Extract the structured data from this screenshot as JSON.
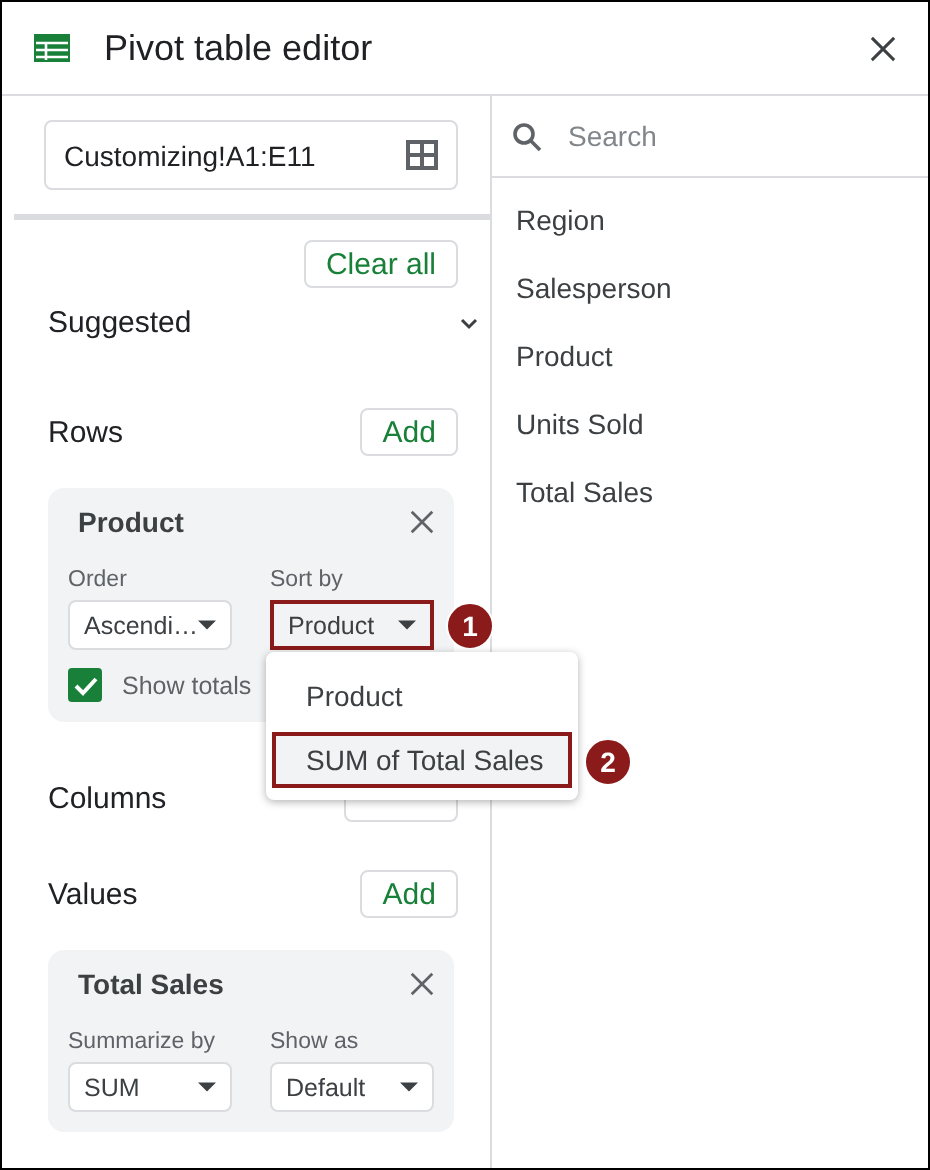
{
  "window": {
    "title": "Pivot table editor"
  },
  "range": {
    "value": "Customizing!A1:E11"
  },
  "clear_all": "Clear all",
  "suggested": "Suggested",
  "sections": [
    {
      "label": "Rows",
      "button": "Add",
      "card": {
        "title": "Product",
        "dropdowns": [
          {
            "label": "Order",
            "value": "Ascendi…",
            "highlighted": false
          },
          {
            "label": "Sort by",
            "value": "Product",
            "highlighted": true,
            "callout": "1"
          }
        ],
        "checkbox": {
          "label": "Show totals",
          "checked": true
        }
      }
    },
    {
      "label": "Columns"
    },
    {
      "label": "Values",
      "button": "Add",
      "card": {
        "title": "Total Sales",
        "dropdowns": [
          {
            "label": "Summarize by",
            "value": "SUM",
            "highlighted": false
          },
          {
            "label": "Show as",
            "value": "Default",
            "highlighted": false
          }
        ]
      }
    }
  ],
  "menu": {
    "items": [
      {
        "label": "Product",
        "highlighted": false
      },
      {
        "label": "SUM of Total Sales",
        "highlighted": true,
        "callout": "2"
      }
    ]
  },
  "search": {
    "placeholder": "Search"
  },
  "fields": [
    "Region",
    "Salesperson",
    "Product",
    "Units Sold",
    "Total Sales"
  ]
}
